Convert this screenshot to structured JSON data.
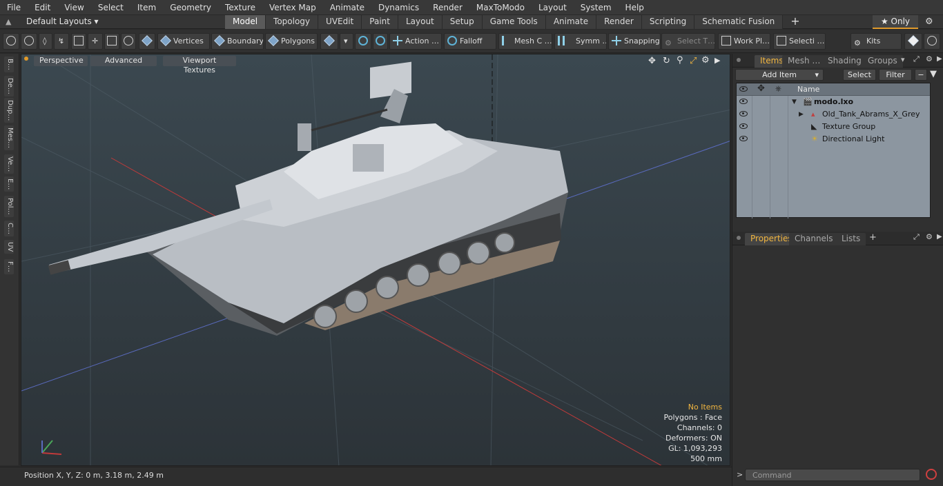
{
  "menubar": [
    "File",
    "Edit",
    "View",
    "Select",
    "Item",
    "Geometry",
    "Texture",
    "Vertex Map",
    "Animate",
    "Dynamics",
    "Render",
    "MaxToModo",
    "Layout",
    "System",
    "Help"
  ],
  "layouts_label": "Default Layouts ▾",
  "tabs": [
    {
      "label": "Model",
      "active": true
    },
    {
      "label": "Topology",
      "active": false
    },
    {
      "label": "UVEdit",
      "active": false
    },
    {
      "label": "Paint",
      "active": false
    },
    {
      "label": "Layout",
      "active": false
    },
    {
      "label": "Setup",
      "active": false
    },
    {
      "label": "Game Tools",
      "active": false
    },
    {
      "label": "Animate",
      "active": false
    },
    {
      "label": "Render",
      "active": false
    },
    {
      "label": "Scripting",
      "active": false
    },
    {
      "label": "Schematic Fusion",
      "active": false
    }
  ],
  "only_label": "★  Only",
  "toolbar": {
    "vertices": "Vertices",
    "boundary": "Boundary",
    "polygons": "Polygons",
    "action": "Action  …",
    "falloff": "Falloff",
    "mesh_c": "Mesh C …",
    "symm": "Symm …",
    "snapping": "Snapping",
    "select_t": "Select T…",
    "work_pl": "Work Pl…",
    "selecti": "Selecti …",
    "kits": "Kits"
  },
  "leftstrip": [
    "B…",
    "De…",
    "Dup…",
    "Mes…",
    "Ve…",
    "E…",
    "Pol…",
    "C…",
    "UV",
    "F…"
  ],
  "viewport": {
    "perspective": "Perspective",
    "advanced": "Advanced",
    "viewport_textures": "Viewport Textures",
    "info": {
      "no_items": "No Items",
      "polygons": "Polygons : Face",
      "channels": "Channels: 0",
      "deformers": "Deformers: ON",
      "gl": "GL: 1,093,293",
      "scale": "500 mm"
    }
  },
  "status": {
    "position": "Position X, Y, Z:   0 m, 3.18 m, 2.49 m"
  },
  "rpanel": {
    "tabs": [
      "Items",
      "Mesh …",
      "Shading",
      "Groups"
    ],
    "add_item": "Add Item",
    "select": "Select",
    "filter": "Filter",
    "name_header": "Name",
    "items": [
      {
        "label": "modo.lxo",
        "bold": true
      },
      {
        "label": "Old_Tank_Abrams_X_Grey",
        "bold": false
      },
      {
        "label": "Texture Group",
        "bold": false
      },
      {
        "label": "Directional Light",
        "bold": false
      }
    ],
    "lower_tabs": [
      "Properties",
      "Channels",
      "Lists"
    ],
    "command_placeholder": "Command"
  },
  "colors": {
    "accent": "#f2b640",
    "viewport_top": "#3b4850",
    "viewport_bottom": "#2c3338"
  }
}
